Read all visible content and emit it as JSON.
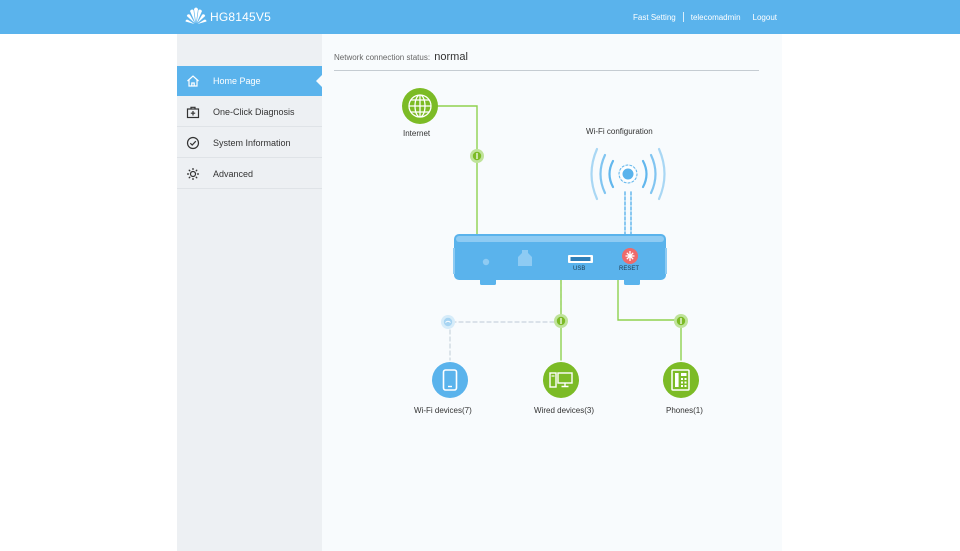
{
  "header": {
    "brand": "HG8145V5",
    "nav": {
      "fast_setting": "Fast Setting",
      "user": "telecomadmin",
      "logout": "Logout"
    }
  },
  "sidebar": {
    "items": [
      {
        "label": "Home Page",
        "icon": "home-icon",
        "active": true
      },
      {
        "label": "One-Click Diagnosis",
        "icon": "medical-kit-icon",
        "active": false
      },
      {
        "label": "System Information",
        "icon": "check-circle-icon",
        "active": false
      },
      {
        "label": "Advanced",
        "icon": "gear-icon",
        "active": false
      }
    ]
  },
  "main": {
    "status_label": "Network connection status:",
    "status_value": "normal",
    "diagram": {
      "internet_label": "Internet",
      "wifi_config_label": "Wi-Fi configuration",
      "usb_label": "USB",
      "reset_label": "RESET",
      "wifi_devices_label": "Wi-Fi devices(7)",
      "wired_devices_label": "Wired devices(3)",
      "phones_label": "Phones(1)"
    }
  },
  "colors": {
    "header_bg": "#5ab3ec",
    "accent_green": "#7cbb26",
    "accent_blue": "#5ab3ec",
    "reset_red": "#ef6a6a"
  }
}
